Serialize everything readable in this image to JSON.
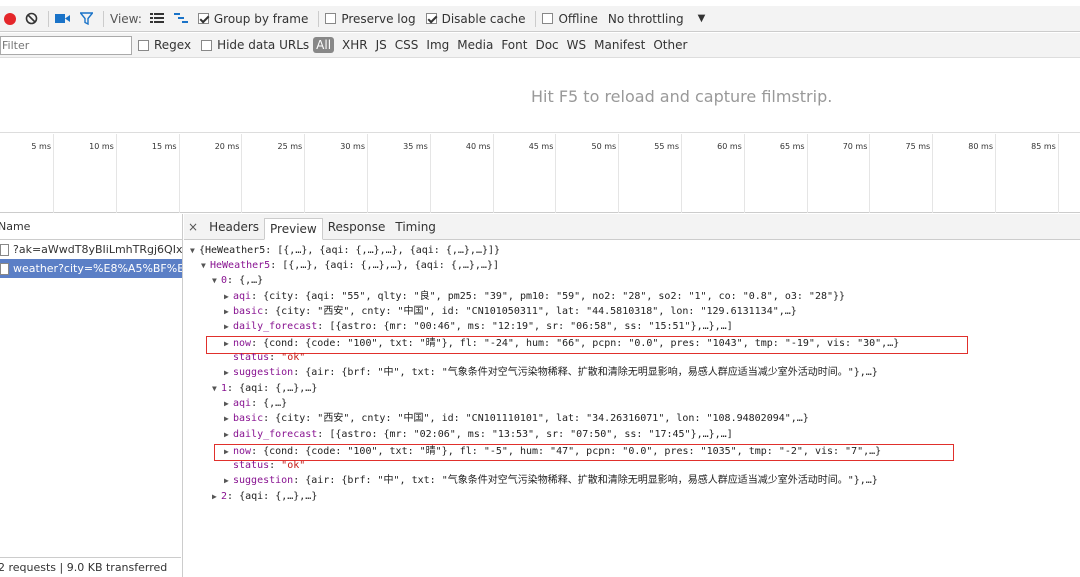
{
  "toolbar": {
    "view_label": "View:",
    "group_by_frame": "Group by frame",
    "preserve_log": "Preserve log",
    "disable_cache": "Disable cache",
    "offline": "Offline",
    "throttling": "No throttling"
  },
  "filterbar": {
    "filter_placeholder": "Filter",
    "regex": "Regex",
    "hide_data_urls": "Hide data URLs",
    "types": [
      "All",
      "XHR",
      "JS",
      "CSS",
      "Img",
      "Media",
      "Font",
      "Doc",
      "WS",
      "Manifest",
      "Other"
    ]
  },
  "filmstrip": {
    "hint": "Hit F5 to reload and capture filmstrip."
  },
  "timeline": {
    "ticks": [
      "5 ms",
      "10 ms",
      "15 ms",
      "20 ms",
      "25 ms",
      "30 ms",
      "35 ms",
      "40 ms",
      "45 ms",
      "50 ms",
      "55 ms",
      "60 ms",
      "65 ms",
      "70 ms",
      "75 ms",
      "80 ms",
      "85 ms"
    ]
  },
  "requests": {
    "header": "Name",
    "rows": [
      "?ak=aWwdT8yBIiLmhTRgj6QIx...",
      "weather?city=%E8%A5%BF%E..."
    ],
    "footer": "2 requests  |  9.0 KB transferred"
  },
  "detail": {
    "close": "×",
    "tabs": [
      "Headers",
      "Preview",
      "Response",
      "Timing"
    ],
    "active_tab": "Preview"
  },
  "preview": {
    "root": "{HeWeather5: [{,…}, {aqi: {,…},…}, {aqi: {,…},…}]}",
    "heweather_key": "HeWeather5",
    "heweather_val": ": [{,…}, {aqi: {,…},…}, {aqi: {,…},…}]",
    "item0_key": "0",
    "item0_val": ": {,…}",
    "aqi0_key": "aqi",
    "aqi0_val": ": {city: {aqi: \"55\", qlty: \"良\", pm25: \"39\", pm10: \"59\", no2: \"28\", so2: \"1\", co: \"0.8\", o3: \"28\"}}",
    "basic0_key": "basic",
    "basic0_val": ": {city: \"西安\", cnty: \"中国\", id: \"CN101050311\", lat: \"44.5810318\", lon: \"129.6131134\",…}",
    "daily0_key": "daily_forecast",
    "daily0_val": ": [{astro: {mr: \"00:46\", ms: \"12:19\", sr: \"06:58\", ss: \"15:51\"},…},…]",
    "now0_key": "now",
    "now0_val": ": {cond: {code: \"100\", txt: \"晴\"}, fl: \"-24\", hum: \"66\", pcpn: \"0.0\", pres: \"1043\", tmp: \"-19\", vis: \"30\",…}",
    "status0_key": "status",
    "status0_val": "\"ok\"",
    "sugg0_key": "suggestion",
    "sugg0_val": ": {air: {brf: \"中\", txt: \"气象条件对空气污染物稀释、扩散和清除无明显影响，易感人群应适当减少室外活动时间。\"},…}",
    "item1_key": "1",
    "item1_val": ": {aqi: {,…},…}",
    "aqi1_key": "aqi",
    "aqi1_val": ": {,…}",
    "basic1_key": "basic",
    "basic1_val": ": {city: \"西安\", cnty: \"中国\", id: \"CN101110101\", lat: \"34.26316071\", lon: \"108.94802094\",…}",
    "daily1_key": "daily_forecast",
    "daily1_val": ": [{astro: {mr: \"02:06\", ms: \"13:53\", sr: \"07:50\", ss: \"17:45\"},…},…]",
    "now1_key": "now",
    "now1_val": ": {cond: {code: \"100\", txt: \"晴\"}, fl: \"-5\", hum: \"47\", pcpn: \"0.0\", pres: \"1035\", tmp: \"-2\", vis: \"7\",…}",
    "status1_key": "status",
    "status1_val": "\"ok\"",
    "sugg1_key": "suggestion",
    "sugg1_val": ": {air: {brf: \"中\", txt: \"气象条件对空气污染物稀释、扩散和清除无明显影响，易感人群应适当减少室外活动时间。\"},…}",
    "item2_key": "2",
    "item2_val": ": {aqi: {,…},…}"
  },
  "colors": {
    "record": "#e4262a",
    "selected_row": "#5b7fc6",
    "highlight_box": "#e0302c",
    "json_key": "#881391",
    "json_string": "#c41a16"
  }
}
